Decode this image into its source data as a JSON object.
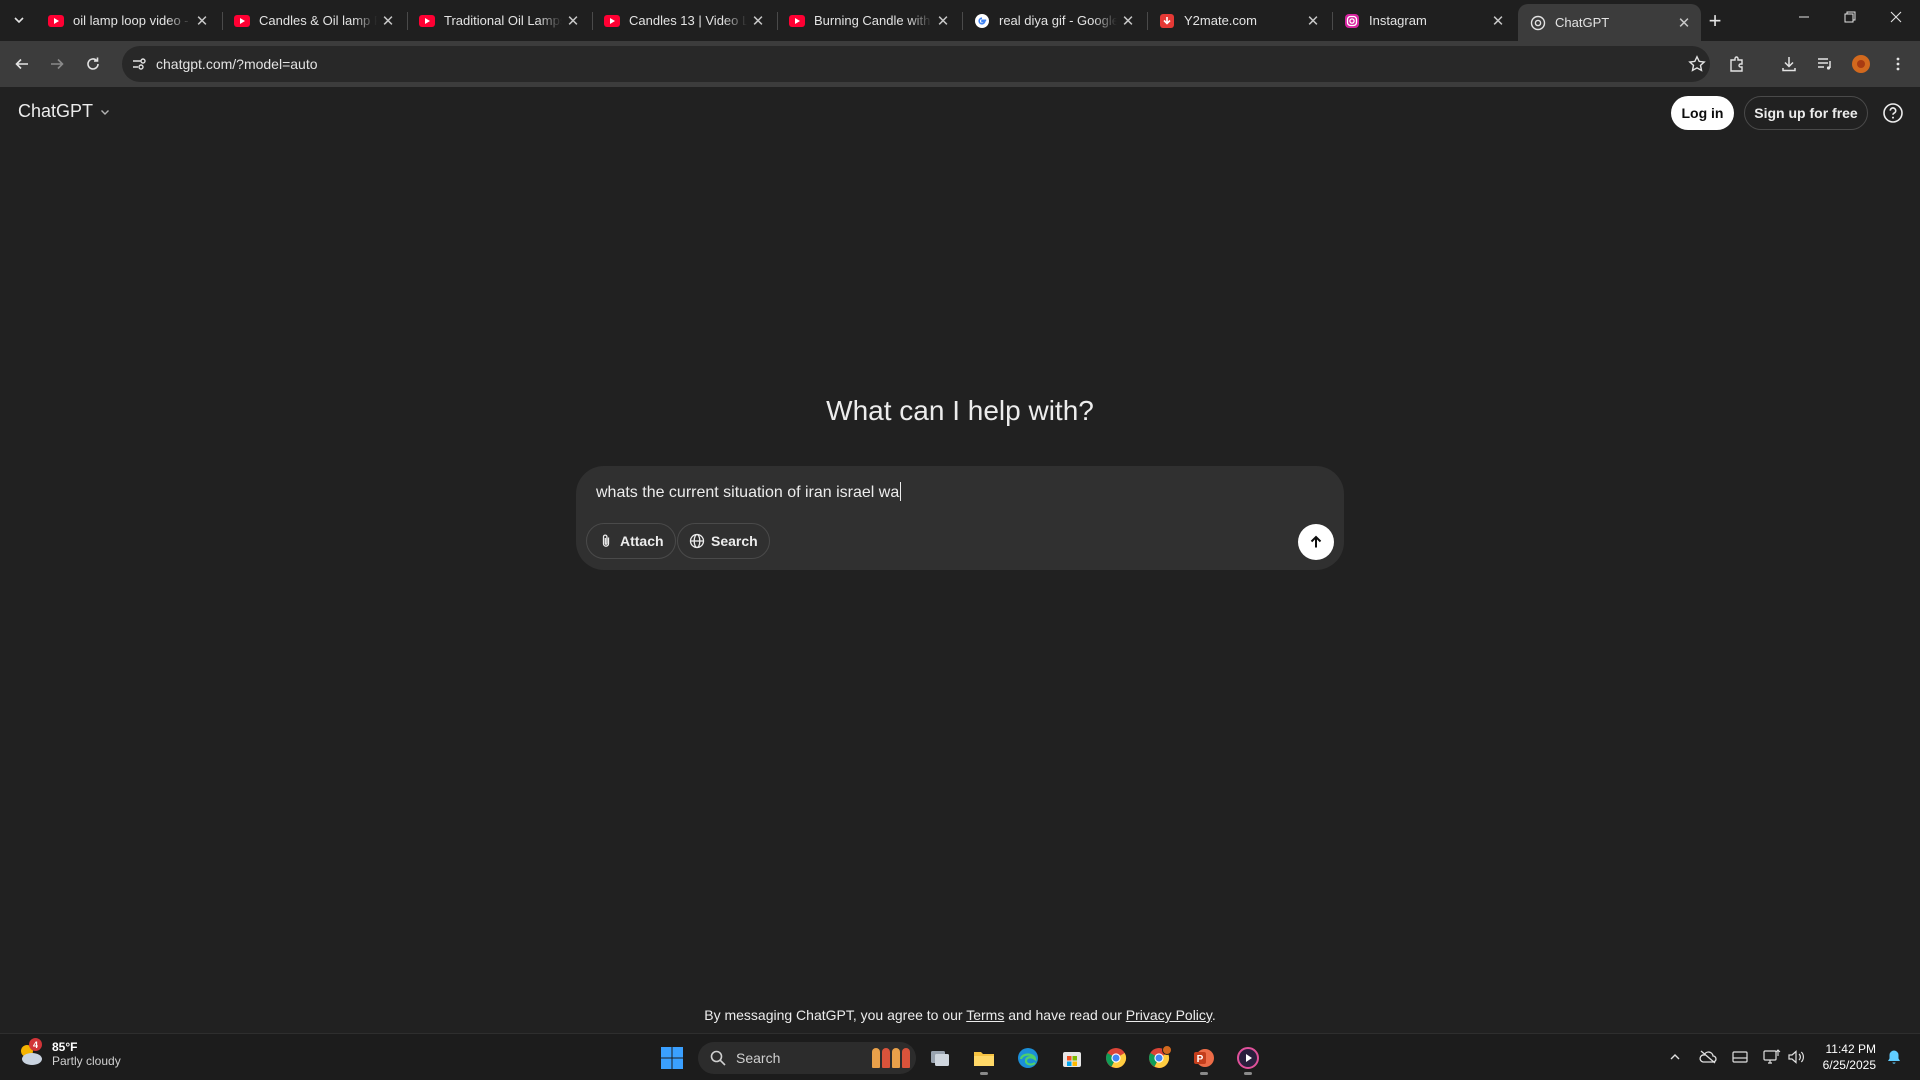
{
  "browser": {
    "tabs": [
      {
        "title": "oil lamp loop video -",
        "favicon": "youtube-icon"
      },
      {
        "title": "Candles & Oil lamp Fl",
        "favicon": "youtube-icon"
      },
      {
        "title": "Traditional Oil Lamps",
        "favicon": "youtube-icon"
      },
      {
        "title": "Candles 13 | Video Lo",
        "favicon": "youtube-icon"
      },
      {
        "title": "Burning Candle with l",
        "favicon": "youtube-icon"
      },
      {
        "title": "real diya gif - Google",
        "favicon": "google-icon"
      },
      {
        "title": "Y2mate.com",
        "favicon": "y2mate-icon"
      },
      {
        "title": "Instagram",
        "favicon": "instagram-icon"
      },
      {
        "title": "ChatGPT",
        "favicon": "chatgpt-icon",
        "active": true
      }
    ],
    "url": "chatgpt.com/?model=auto"
  },
  "page": {
    "brand": "ChatGPT",
    "login_label": "Log in",
    "signup_label": "Sign up for free",
    "headline": "What can I help with?",
    "composer": {
      "text": "whats the current situation of iran israel wa",
      "attach_label": "Attach",
      "search_label": "Search"
    },
    "footer": {
      "prefix": "By messaging ChatGPT, you agree to our ",
      "terms": "Terms",
      "middle": " and have read our ",
      "privacy": "Privacy Policy",
      "suffix": "."
    }
  },
  "taskbar": {
    "weather_temp": "85°F",
    "weather_desc": "Partly cloudy",
    "weather_badge": "4",
    "search_label": "Search",
    "time": "11:42 PM",
    "date": "6/25/2025"
  },
  "colors": {
    "page_bg": "#212121",
    "composer_bg": "#303030",
    "youtube_red": "#ff0033",
    "taskbar_bg": "#1c1c1c"
  }
}
